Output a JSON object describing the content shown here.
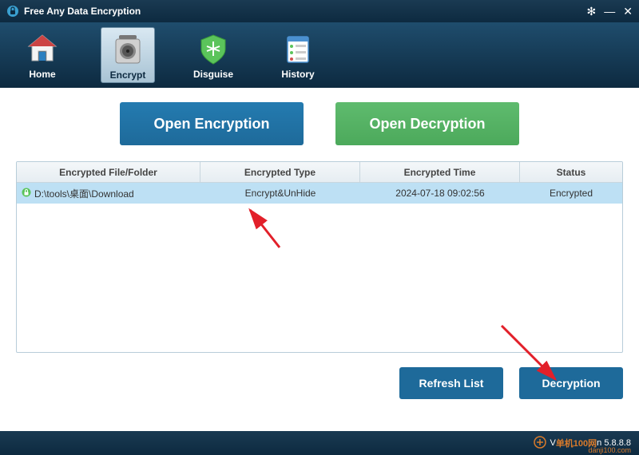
{
  "app": {
    "title": "Free Any Data Encryption"
  },
  "nav": {
    "home": "Home",
    "encrypt": "Encrypt",
    "disguise": "Disguise",
    "history": "History"
  },
  "actions": {
    "open_encryption": "Open Encryption",
    "open_decryption": "Open Decryption"
  },
  "table": {
    "headers": {
      "file": "Encrypted File/Folder",
      "type": "Encrypted Type",
      "time": "Encrypted Time",
      "status": "Status"
    },
    "rows": [
      {
        "file": "D:\\tools\\桌面\\Download",
        "type": "Encrypt&UnHide",
        "time": "2024-07-18 09:02:56",
        "status": "Encrypted"
      }
    ]
  },
  "buttons": {
    "refresh": "Refresh List",
    "decryption": "Decryption"
  },
  "footer": {
    "version_prefix": "V",
    "watermark": "单机100网",
    "version_suffix": "n 5.8.8.8",
    "watermark_sub": "danji100.com"
  }
}
